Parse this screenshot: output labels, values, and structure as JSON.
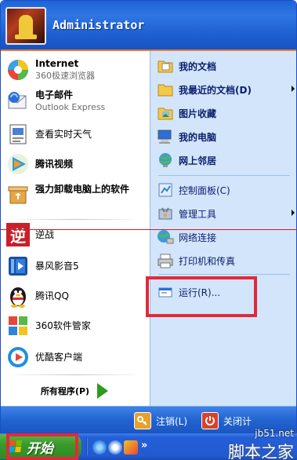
{
  "header": {
    "username": "Administrator"
  },
  "left_items": [
    {
      "title": "Internet",
      "subtitle": "360极速浏览器",
      "icon": "360-browser-icon"
    },
    {
      "title": "电子邮件",
      "subtitle": "Outlook Express",
      "icon": "outlook-express-icon"
    },
    {
      "title": "查看实时天气",
      "icon": "weather-icon"
    },
    {
      "title": "腾讯视频",
      "icon": "tencent-video-icon"
    },
    {
      "title": "强力卸载电脑上的软件",
      "icon": "uninstaller-icon"
    }
  ],
  "recent_items": [
    {
      "label": "逆战",
      "icon": "nizhan-game-icon"
    },
    {
      "label": "暴风影音5",
      "icon": "baofeng-player-icon"
    },
    {
      "label": "腾讯QQ",
      "icon": "qq-penguin-icon"
    },
    {
      "label": "360软件管家",
      "icon": "360-software-manager-icon"
    },
    {
      "label": "优酷客户端",
      "icon": "youku-client-icon"
    }
  ],
  "all_programs": {
    "label": "所有程序(P)"
  },
  "right_items": [
    {
      "label": "我的文档",
      "icon": "my-documents-icon"
    },
    {
      "label": "我最近的文档(D)",
      "icon": "recent-documents-icon",
      "submenu": true
    },
    {
      "label": "图片收藏",
      "icon": "my-pictures-icon"
    },
    {
      "label": "我的电脑",
      "icon": "my-computer-icon"
    },
    {
      "label": "网上邻居",
      "icon": "network-places-icon"
    },
    {
      "label": "控制面板(C)",
      "icon": "control-panel-icon"
    },
    {
      "label": "管理工具",
      "icon": "admin-tools-icon",
      "submenu": true
    },
    {
      "label": "网络连接",
      "icon": "network-connections-icon"
    },
    {
      "label": "打印机和传真",
      "icon": "printers-fax-icon"
    },
    {
      "label": "运行(R)...",
      "icon": "run-icon"
    }
  ],
  "footer": {
    "logoff": "注销(L)",
    "shutdown": "关闭计"
  },
  "taskbar": {
    "start_label": "开始"
  },
  "watermark": {
    "site": "jb51.net",
    "name": "脚本之家"
  },
  "colors": {
    "xp_blue": "#245fd8",
    "start_green": "#3a9a2a",
    "highlight_red": "#e2293a"
  }
}
